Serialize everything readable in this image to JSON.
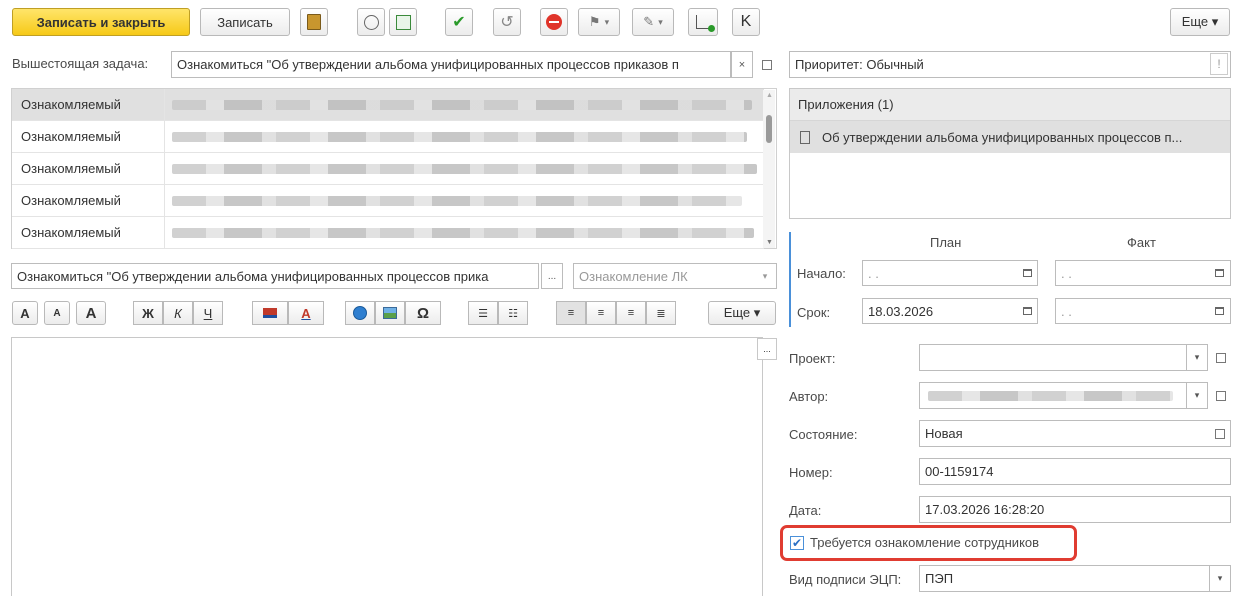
{
  "toolbar": {
    "save_close_label": "Записать и закрыть",
    "save_label": "Записать",
    "k_label": "K",
    "more_label": "Еще ▾"
  },
  "parent_task": {
    "label": "Вышестоящая задача:",
    "value": "Ознакомиться \"Об утверждении альбома унифицированных процессов приказов п",
    "clear_glyph": "×"
  },
  "priority": {
    "value": "Приоритет: Обычный",
    "glyph": "!"
  },
  "participants": {
    "rows": [
      {
        "role": "Ознакомляемый"
      },
      {
        "role": "Ознакомляемый"
      },
      {
        "role": "Ознакомляемый"
      },
      {
        "role": "Ознакомляемый"
      },
      {
        "role": "Ознакомляемый"
      }
    ]
  },
  "attachments": {
    "header": "Приложения (1)",
    "items": [
      "Об утверждении альбома унифицированных процессов п..."
    ]
  },
  "subject": {
    "value": "Ознакомиться  \"Об утверждении альбома унифицированных процессов прика",
    "dots": "...",
    "type_value": "Ознакомление ЛК"
  },
  "format_bar": {
    "bold": "Ж",
    "italic": "К",
    "underline": "Ч",
    "omega": "Ω",
    "a_big": "A",
    "a_small": "A",
    "a_plain": "A",
    "a_color": "A",
    "more_label": "Еще ▾"
  },
  "editor": {
    "dots": "..."
  },
  "dates": {
    "plan_header": "План",
    "fact_header": "Факт",
    "start_label": "Начало:",
    "start_plan": ". .",
    "start_fact": ". .",
    "due_label": "Срок:",
    "due_plan": "18.03.2026",
    "due_fact": ". ."
  },
  "props": {
    "project_label": "Проект:",
    "project_value": "",
    "author_label": "Автор:",
    "state_label": "Состояние:",
    "state_value": "Новая",
    "number_label": "Номер:",
    "number_value": "00-1159174",
    "date_label": "Дата:",
    "date_value": "17.03.2026 16:28:20",
    "requires_ack_label": "Требуется ознакомление сотрудников",
    "requires_ack_checked": true,
    "sign_label": "Вид подписи ЭЦП:",
    "sign_value": "ПЭП"
  },
  "colors": {
    "accent_blue": "#4a90d9",
    "highlight_red": "#e03c31",
    "primary_yellow": "#f6c917"
  }
}
